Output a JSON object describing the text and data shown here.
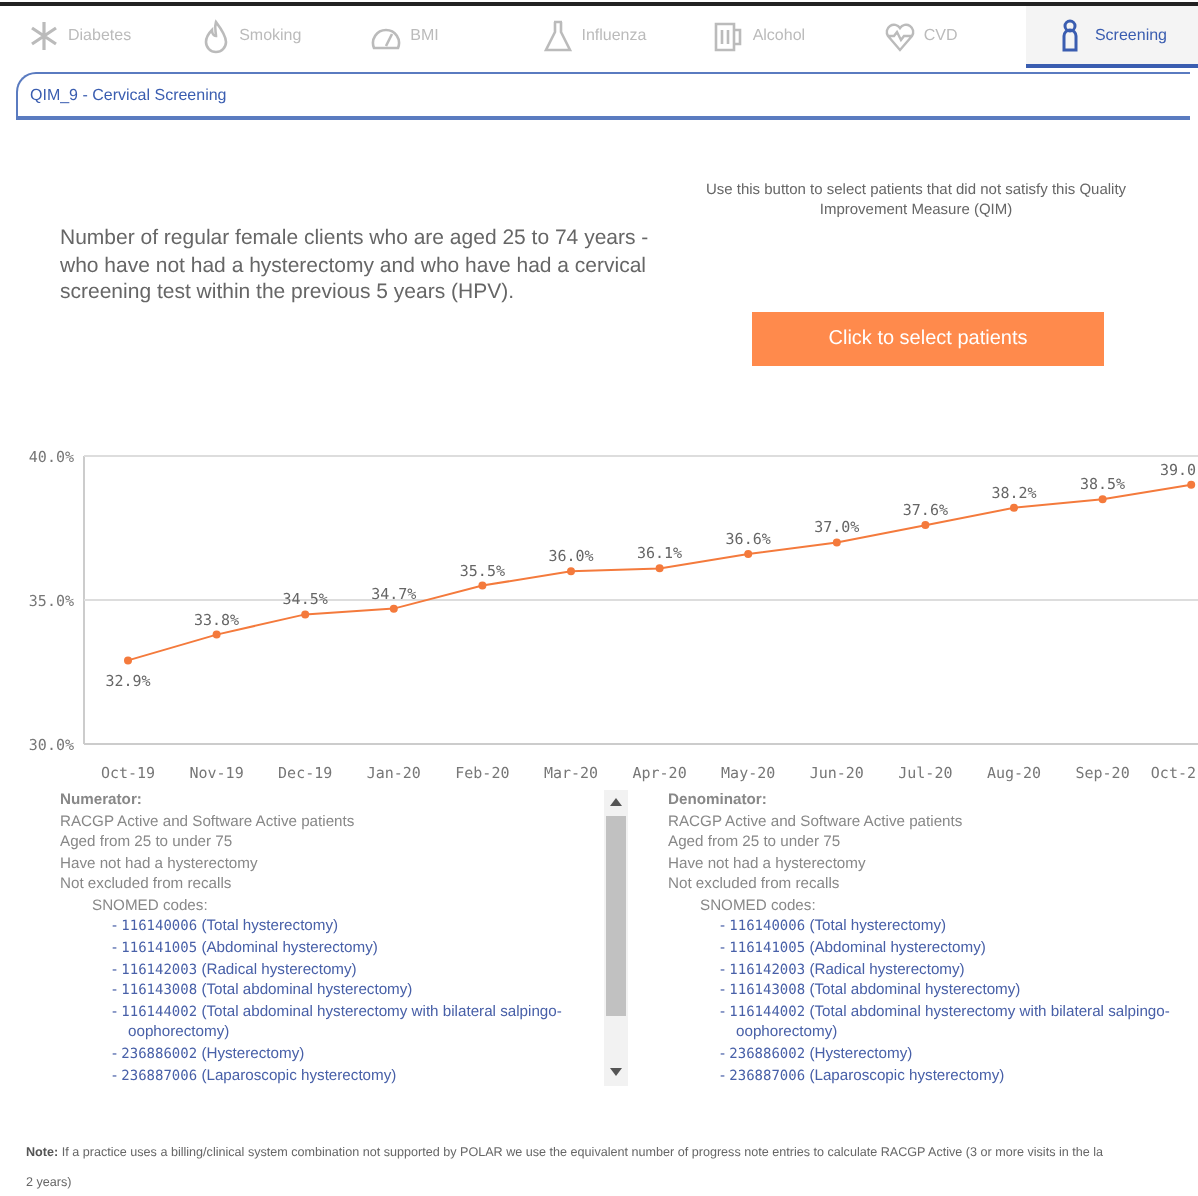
{
  "tabs": [
    {
      "label": "Diabetes",
      "selected": false
    },
    {
      "label": "Smoking",
      "selected": false
    },
    {
      "label": "BMI",
      "selected": false
    },
    {
      "label": "Influenza",
      "selected": false
    },
    {
      "label": "Alcohol",
      "selected": false
    },
    {
      "label": "CVD",
      "selected": false
    },
    {
      "label": "Screening",
      "selected": true
    }
  ],
  "subtab": {
    "label": "QIM_9 - Cervical Screening"
  },
  "description": "Number of regular female clients who are aged 25 to 74 years - who have not had a hysterectomy and who have had a cervical screening test within the previous 5 years (HPV).",
  "button_hint": "Use this button to select patients that did not satisfy this Quality Improvement Measure (QIM)",
  "select_button": "Click to select patients",
  "chart_data": {
    "type": "line",
    "categories": [
      "Oct-19",
      "Nov-19",
      "Dec-19",
      "Jan-20",
      "Feb-20",
      "Mar-20",
      "Apr-20",
      "May-20",
      "Jun-20",
      "Jul-20",
      "Aug-20",
      "Sep-20",
      "Oct-2"
    ],
    "series": [
      {
        "color": "#f47a3c",
        "marker": true,
        "values": [
          32.9,
          33.8,
          34.5,
          34.7,
          35.5,
          36.0,
          36.1,
          36.6,
          37.0,
          37.6,
          38.2,
          38.5,
          39.0
        ]
      }
    ],
    "ylim": [
      30,
      40
    ],
    "yticks": [
      {
        "value": 30,
        "label": "30.0%"
      },
      {
        "value": 35,
        "label": "35.0%"
      },
      {
        "value": 40,
        "label": "40.0%"
      }
    ],
    "value_labels": [
      "32.9%",
      "33.8%",
      "34.5%",
      "34.7%",
      "35.5%",
      "36.0%",
      "36.1%",
      "36.6%",
      "37.0%",
      "37.6%",
      "38.2%",
      "38.5%",
      "39.0"
    ]
  },
  "criteria": [
    {
      "heading": "Numerator:",
      "lines": [
        "RACGP Active and Software Active patients",
        "Aged from 25 to under 75",
        "Have not had a hysterectomy",
        "Not excluded from recalls"
      ],
      "codes_heading": "SNOMED codes:",
      "codes": [
        {
          "bullet": "-",
          "code": "116140006",
          "description": "(Total hysterectomy)"
        },
        {
          "bullet": "-",
          "code": "116141005",
          "description": "(Abdominal hysterectomy)"
        },
        {
          "bullet": "-",
          "code": "116142003",
          "description": "(Radical hysterectomy)"
        },
        {
          "bullet": "-",
          "code": "116143008",
          "description": "(Total abdominal hysterectomy)"
        },
        {
          "bullet": "-",
          "code": "116144002",
          "description": "(Total abdominal hysterectomy with bilateral salpingo-oophorectomy)"
        },
        {
          "bullet": "-",
          "code": "236886002",
          "description": "(Hysterectomy)"
        },
        {
          "bullet": "-",
          "code": "236887006",
          "description": "(Laparoscopic hysterectomy)"
        }
      ]
    },
    {
      "heading": "Denominator:",
      "lines": [
        "RACGP Active and Software Active patients",
        "Aged from 25 to under 75",
        "Have not had a hysterectomy",
        "Not excluded from recalls"
      ],
      "codes_heading": "SNOMED codes:",
      "codes": [
        {
          "bullet": "-",
          "code": "116140006",
          "description": "(Total hysterectomy)"
        },
        {
          "bullet": "-",
          "code": "116141005",
          "description": "(Abdominal hysterectomy)"
        },
        {
          "bullet": "-",
          "code": "116142003",
          "description": "(Radical hysterectomy)"
        },
        {
          "bullet": "-",
          "code": "116143008",
          "description": "(Total abdominal hysterectomy)"
        },
        {
          "bullet": "-",
          "code": "116144002",
          "description": "(Total abdominal hysterectomy with bilateral salpingo-oophorectomy)"
        },
        {
          "bullet": "-",
          "code": "236886002",
          "description": "(Hysterectomy)"
        },
        {
          "bullet": "-",
          "code": "236887006",
          "description": "(Laparoscopic hysterectomy)"
        }
      ]
    }
  ],
  "note": [
    "**Note:** If a practice uses a billing/clinical system combination not supported by POLAR we use the equivalent number of progress note entries to calculate RACGP Active (3 or more visits in the la",
    "2 years)"
  ]
}
